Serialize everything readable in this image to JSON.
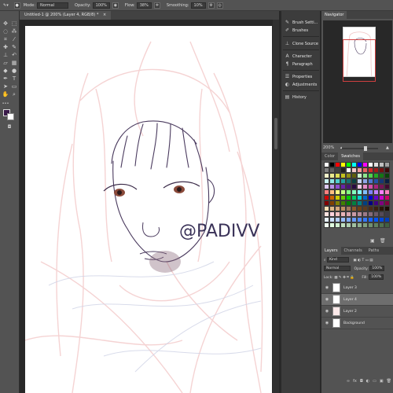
{
  "options_bar": {
    "mode_label": "Mode:",
    "mode_value": "Normal",
    "opacity_label": "Opacity:",
    "opacity_value": "100%",
    "flow_label": "Flow:",
    "flow_value": "38%",
    "smoothing_label": "Smoothing:",
    "smoothing_value": "10%"
  },
  "document_tab": {
    "title": "Untitled-1 @ 200% (Layer 4, RGB/8) *"
  },
  "middle_panels": [
    {
      "label": "Brush Setti...",
      "icon": "brush-settings-icon"
    },
    {
      "label": "Brushes",
      "icon": "brushes-icon"
    },
    {
      "label": "Clone Source",
      "icon": "clone-source-icon"
    },
    {
      "label": "Character",
      "icon": "character-icon"
    },
    {
      "label": "Paragraph",
      "icon": "paragraph-icon"
    },
    {
      "label": "Properties",
      "icon": "properties-icon"
    },
    {
      "label": "Adjustments",
      "icon": "adjustments-icon"
    },
    {
      "label": "History",
      "icon": "history-icon"
    }
  ],
  "navigator": {
    "tab": "Navigator",
    "zoom": "200%"
  },
  "color_panel": {
    "tab_color": "Color",
    "tab_swatches": "Swatches"
  },
  "swatch_colors": [
    "#ffffff",
    "#000000",
    "#ff0000",
    "#ffff00",
    "#00ff00",
    "#00ffff",
    "#0000ff",
    "#ff00ff",
    "#ffffff",
    "#e0e0e0",
    "#c0c0c0",
    "#a0a0a0",
    "#808080",
    "#606060",
    "#404040",
    "#202020",
    "#ffffff",
    "#f2c9c9",
    "#f29c9c",
    "#e86161",
    "#d42828",
    "#a31818",
    "#731010",
    "#3d0808",
    "#f2f2c9",
    "#eaea8e",
    "#dede55",
    "#c2c21e",
    "#8f8f14",
    "#5e5e0a",
    "#c9f2c9",
    "#8ee68e",
    "#4fd04f",
    "#23a823",
    "#157515",
    "#0a420a",
    "#c9f2f2",
    "#8ee6e6",
    "#4fcfcf",
    "#22a1a1",
    "#167070",
    "#0a4040",
    "#c9d4f2",
    "#8ea6e6",
    "#4f78d0",
    "#2352a8",
    "#173775",
    "#0a1f42",
    "#dcc9f2",
    "#b78ee6",
    "#8e4fd0",
    "#6823a8",
    "#481575",
    "#270a42",
    "#f2c9e6",
    "#e68ec9",
    "#d04fa8",
    "#a8237e",
    "#751556",
    "#420a30",
    "#ff8080",
    "#ffbf80",
    "#ffff80",
    "#bfff80",
    "#80ff80",
    "#80ffbf",
    "#80ffff",
    "#80bfff",
    "#8080ff",
    "#bf80ff",
    "#ff80ff",
    "#ff80bf",
    "#cc0000",
    "#cc6600",
    "#cccc00",
    "#66cc00",
    "#00cc00",
    "#00cc66",
    "#00cccc",
    "#0066cc",
    "#0000cc",
    "#6600cc",
    "#cc00cc",
    "#cc0066",
    "#800000",
    "#804000",
    "#808000",
    "#408000",
    "#008000",
    "#008040",
    "#008080",
    "#004080",
    "#000080",
    "#400080",
    "#800080",
    "#800040",
    "#f5deb3",
    "#deb887",
    "#d2a679",
    "#bc8f5f",
    "#a0785a",
    "#8b5a2b",
    "#704214",
    "#5c3a1e",
    "#4a2c17",
    "#3a2010",
    "#2a160a",
    "#1a0c04",
    "#ffe4e1",
    "#ffd1dc",
    "#f4c2c2",
    "#e8b4b8",
    "#d8a7b1",
    "#c99aa6",
    "#b48a97",
    "#9c7a88",
    "#846a78",
    "#6c5a68",
    "#544a58",
    "#3c3a48",
    "#e6f2ff",
    "#cce0ff",
    "#b3ceff",
    "#99bdff",
    "#80abff",
    "#6699ff",
    "#4d88ff",
    "#3376ff",
    "#1a64ff",
    "#0052ff",
    "#0047db",
    "#003cb8",
    "#f0fff0",
    "#e0ffe0",
    "#d0f0d0",
    "#c0e0c0",
    "#b0d0b0",
    "#a0c0a0",
    "#90b090",
    "#80a080",
    "#709070",
    "#608060",
    "#507050",
    "#406040"
  ],
  "layers_panel": {
    "tab_layers": "Layers",
    "tab_channels": "Channels",
    "tab_paths": "Paths",
    "kind_label": "Kind",
    "blend_mode": "Normal",
    "opacity_label": "Opacity:",
    "opacity_value": "100%",
    "lock_label": "Lock:",
    "fill_label": "Fill:",
    "fill_value": "100%",
    "layers": [
      {
        "name": "Layer 3"
      },
      {
        "name": "Layer 4"
      },
      {
        "name": "Layer 2"
      },
      {
        "name": "Background"
      }
    ]
  },
  "canvas": {
    "watermark": "@PADIVV"
  }
}
